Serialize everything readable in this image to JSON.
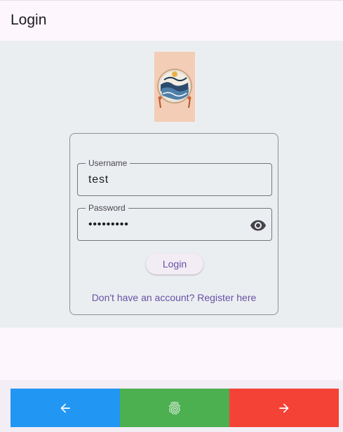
{
  "app_bar": {
    "title": "Login"
  },
  "form": {
    "username": {
      "label": "Username",
      "value": "test"
    },
    "password": {
      "label": "Password",
      "value": "•••••••••",
      "toggle_icon": "eye-icon"
    },
    "login_button": "Login",
    "register_link": "Don't have an account? Register here"
  },
  "bottom_nav": {
    "buttons": [
      {
        "icon": "arrow-left-icon",
        "color": "#2196f3"
      },
      {
        "icon": "fingerprint-icon",
        "color": "#4caf50"
      },
      {
        "icon": "arrow-right-icon",
        "color": "#f44336"
      }
    ]
  },
  "colors": {
    "primary": "#6750a4",
    "background": "#fdf7fd",
    "body": "#ebeef1"
  }
}
